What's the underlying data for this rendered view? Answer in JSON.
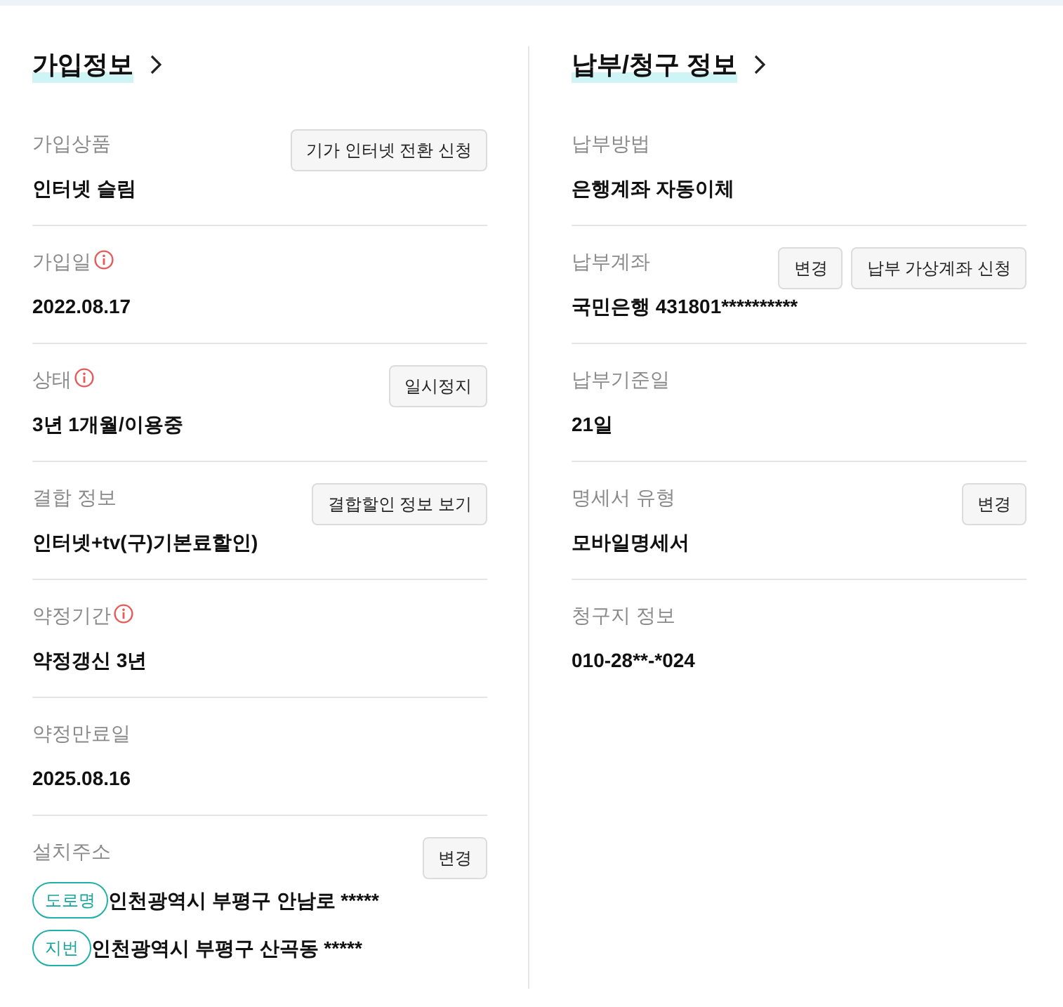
{
  "sections": [
    {
      "title": "가입정보",
      "items": [
        {
          "kind": "text",
          "label": "가입상품",
          "info": false,
          "value": "인터넷 슬림",
          "buttons": [
            "기가 인터넷 전환 신청"
          ]
        },
        {
          "kind": "text",
          "label": "가입일",
          "info": true,
          "value": "2022.08.17"
        },
        {
          "kind": "text",
          "label": "상태",
          "info": true,
          "value": "3년 1개월/이용중",
          "buttons": [
            "일시정지"
          ]
        },
        {
          "kind": "text",
          "label": "결합 정보",
          "info": false,
          "value": "인터넷+tv(구)기본료할인)",
          "buttons": [
            "결합할인 정보 보기"
          ]
        },
        {
          "kind": "text",
          "label": "약정기간",
          "info": true,
          "value": "약정갱신 3년"
        },
        {
          "kind": "text",
          "label": "약정만료일",
          "info": false,
          "value": "2025.08.16"
        },
        {
          "kind": "address",
          "label": "설치주소",
          "info": false,
          "addresses": [
            {
              "tag": "도로명",
              "text": "인천광역시 부평구 안남로 *****"
            },
            {
              "tag": "지번",
              "text": "인천광역시 부평구 산곡동 *****"
            }
          ],
          "buttons": [
            "변경"
          ]
        }
      ]
    },
    {
      "title": "납부/청구 정보",
      "items": [
        {
          "kind": "text",
          "label": "납부방법",
          "info": false,
          "value": "은행계좌 자동이체"
        },
        {
          "kind": "text",
          "label": "납부계좌",
          "info": false,
          "value": "국민은행 431801**********",
          "buttons": [
            "변경",
            "납부 가상계좌 신청"
          ]
        },
        {
          "kind": "text",
          "label": "납부기준일",
          "info": false,
          "value": "21일"
        },
        {
          "kind": "text",
          "label": "명세서 유형",
          "info": false,
          "value": "모바일명세서",
          "buttons": [
            "변경"
          ]
        },
        {
          "kind": "text",
          "label": "청구지 정보",
          "info": false,
          "value": "010-28**-*024"
        }
      ]
    }
  ]
}
